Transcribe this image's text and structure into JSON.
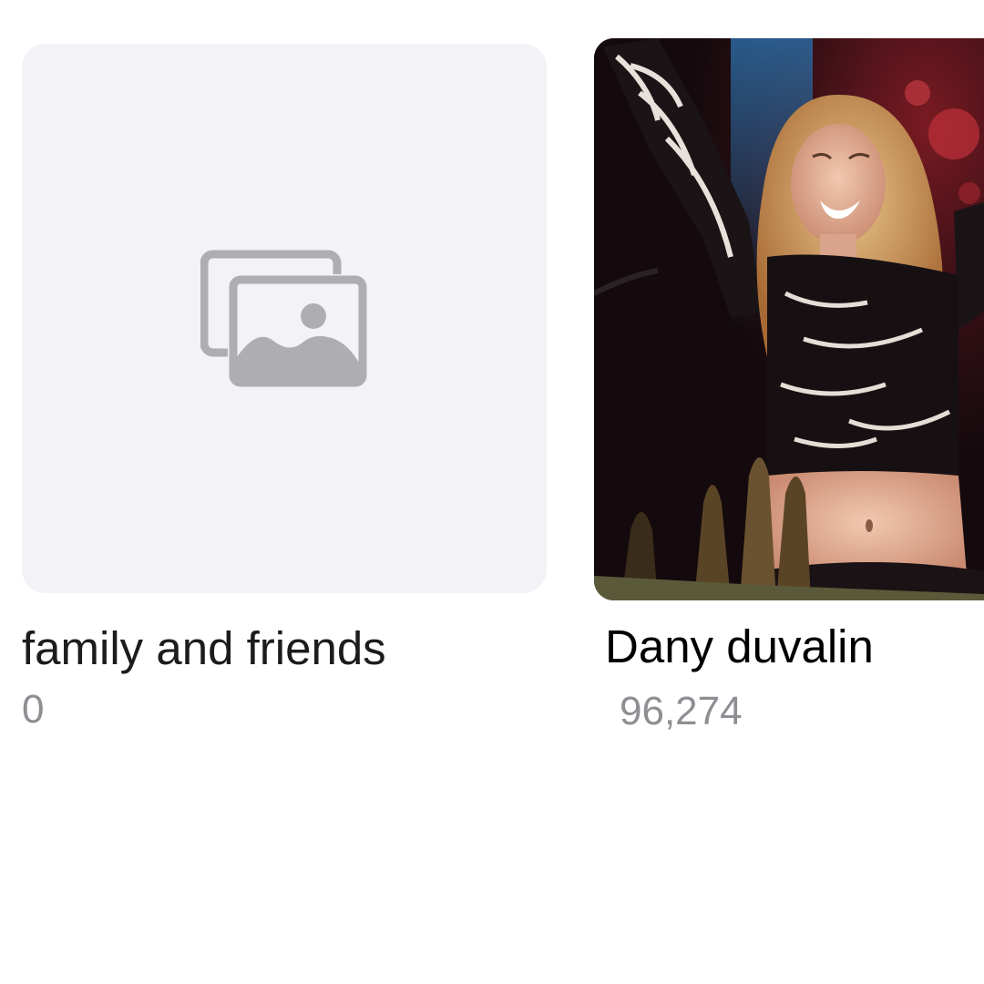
{
  "albums": [
    {
      "title": "family and friends",
      "count": "0",
      "thumbnail_icon": "photo-placeholder-icon"
    },
    {
      "title": "Dany duvalin",
      "count": "96,274",
      "thumbnail_icon": "album-cover-photo"
    }
  ],
  "colors": {
    "placeholder_bg": "#f2f2f7",
    "placeholder_icon": "#aeaeb2",
    "title": "#1c1c1e",
    "count": "#8e8e93"
  }
}
